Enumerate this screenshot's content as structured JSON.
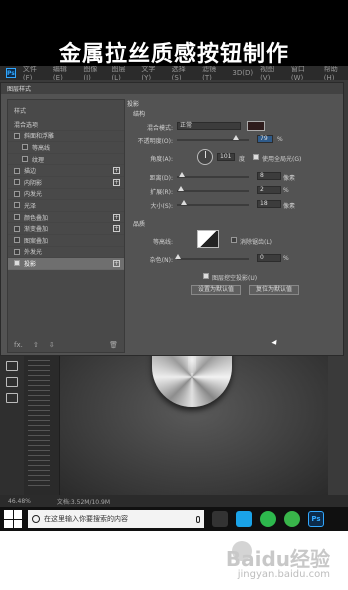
{
  "banner": {
    "title": "金属拉丝质感按钮制作"
  },
  "app": {
    "menu": [
      "文件(F)",
      "编辑(E)",
      "图像(I)",
      "图层(L)",
      "文字(Y)",
      "选择(S)",
      "滤镜(T)",
      "3D(D)",
      "视图(V)",
      "窗口(W)",
      "帮助(H)"
    ]
  },
  "dialog": {
    "title": "图层样式",
    "styles_header": "样式",
    "blend_options": "混合选项",
    "rows": [
      {
        "label": "斜面和浮雕",
        "checked": false,
        "indent": false,
        "plus": false
      },
      {
        "label": "等高线",
        "checked": false,
        "indent": true,
        "plus": false
      },
      {
        "label": "纹理",
        "checked": false,
        "indent": true,
        "plus": false
      },
      {
        "label": "描边",
        "checked": false,
        "indent": false,
        "plus": true
      },
      {
        "label": "内阴影",
        "checked": false,
        "indent": false,
        "plus": true
      },
      {
        "label": "内发光",
        "checked": false,
        "indent": false,
        "plus": false
      },
      {
        "label": "光泽",
        "checked": false,
        "indent": false,
        "plus": false
      },
      {
        "label": "颜色叠加",
        "checked": false,
        "indent": false,
        "plus": true
      },
      {
        "label": "渐变叠加",
        "checked": false,
        "indent": false,
        "plus": true
      },
      {
        "label": "图案叠加",
        "checked": false,
        "indent": false,
        "plus": false
      },
      {
        "label": "外发光",
        "checked": false,
        "indent": false,
        "plus": false
      },
      {
        "label": "投影",
        "checked": true,
        "indent": false,
        "plus": true
      }
    ],
    "footer_fx": "fx."
  },
  "props": {
    "section": "投影",
    "structure": "结构",
    "blend_mode_label": "混合模式:",
    "blend_mode": "正常",
    "opacity_label": "不透明度(O):",
    "opacity": "79",
    "angle_label": "角度(A):",
    "angle": "101",
    "angle_unit": "度",
    "global_light": "使用全局光(G)",
    "distance_label": "距离(D):",
    "distance": "8",
    "spread_label": "扩展(R):",
    "spread": "2",
    "size_label": "大小(S):",
    "size": "18",
    "px": "像素",
    "percent": "%",
    "quality": "品质",
    "contour_label": "等高线:",
    "anti_alias": "消除锯齿(L)",
    "noise_label": "杂色(N):",
    "noise": "0",
    "layer_knocks_out": "图层挖空投影(U)",
    "set_default": "设置为默认值",
    "reset_default": "复位为默认值",
    "swatch_color": "#2e1c1c"
  },
  "status": {
    "zoom": "46.48%",
    "doc": "文档:3.52M/10.9M"
  },
  "taskbar": {
    "search_placeholder": "在这里输入你要搜索的内容",
    "ps": "Ps"
  },
  "watermark": {
    "brand": "Baidu经验",
    "url": "jingyan.baidu.com"
  }
}
